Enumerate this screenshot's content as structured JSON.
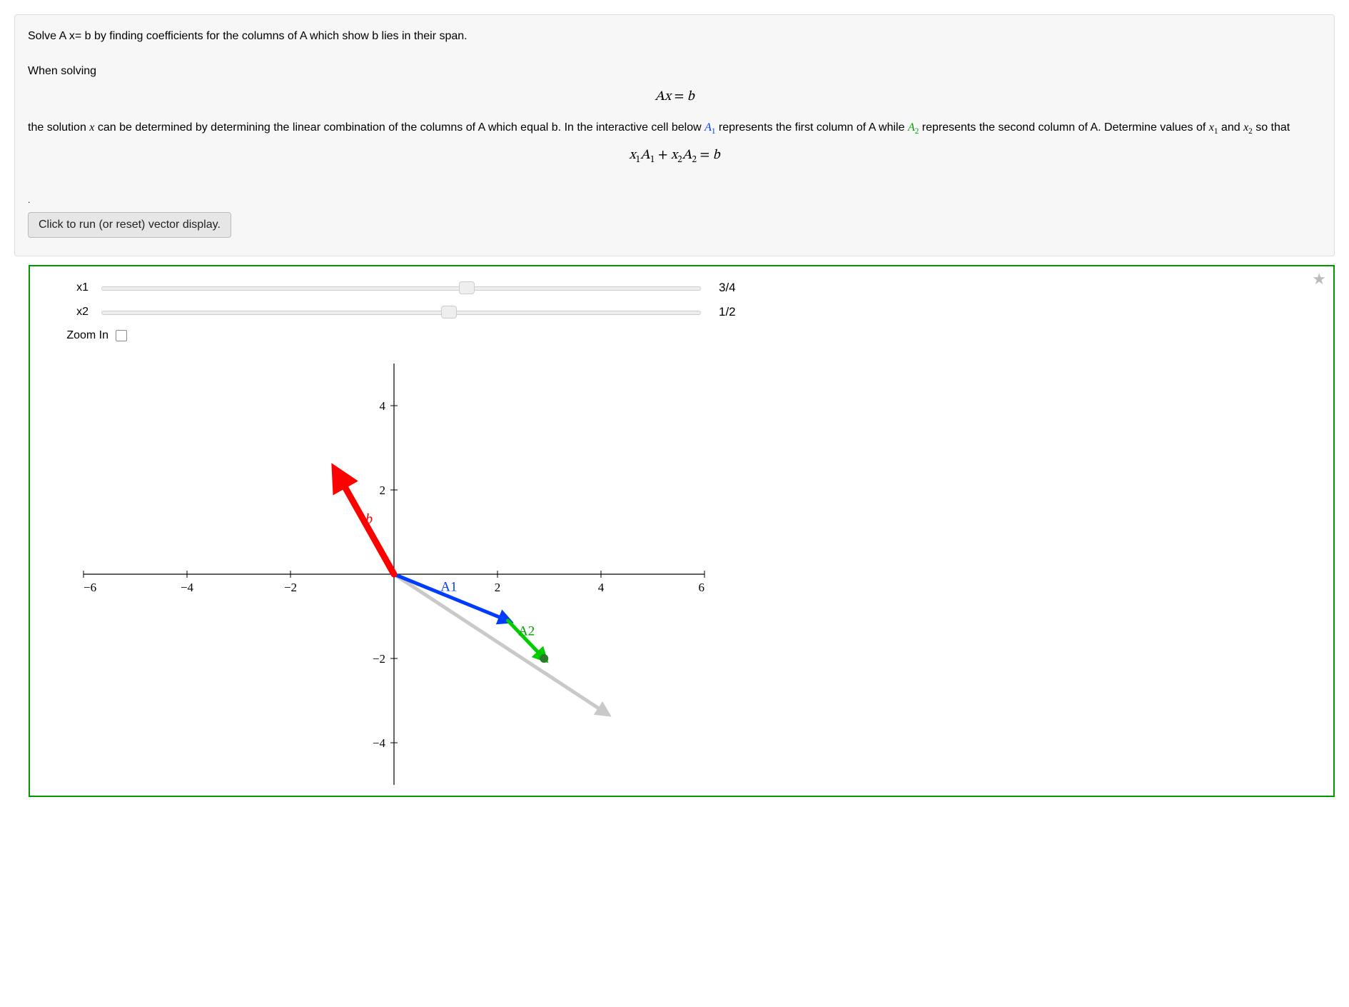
{
  "title": "Solve A x= b by finding coefficients for the columns of A which show b lies in their span.",
  "when": "When solving",
  "eq1": "Ax = b",
  "body1_pre": "the solution ",
  "body1_x": "x",
  "body1_mid1": " can be determined by determining the linear combination of the columns of A which equal b. In the interactive cell below ",
  "body1_A1": "A₁",
  "body1_mid2": " represents the first column of A while ",
  "body1_A2": "A₂",
  "body1_mid3": " represents the second column of A. Determine values of ",
  "body1_x1": "x₁",
  "body1_and": " and ",
  "body1_x2": "x₂",
  "body1_end": " so that",
  "eq2": "x₁A₁ + x₂A₂ = b",
  "run_btn": "Click to run (or reset) vector display.",
  "sliders": {
    "x1": {
      "label": "x1",
      "value": "3/4",
      "pos_pct": 61
    },
    "x2": {
      "label": "x2",
      "value": "1/2",
      "pos_pct": 58
    }
  },
  "zoom_label": "Zoom In",
  "chart_data": {
    "type": "vector-plot",
    "xlim": [
      -6,
      6
    ],
    "ylim": [
      -5,
      5
    ],
    "xticks": [
      -6,
      -4,
      -2,
      2,
      4,
      6
    ],
    "yticks": [
      -4,
      -2,
      2,
      4
    ],
    "vectors": [
      {
        "name": "b",
        "x": -1.1,
        "y": 2.4,
        "color": "#ff0000",
        "thick": 9
      },
      {
        "name": "x1A1",
        "x": 2.2,
        "y": -1.1,
        "color": "#003cff",
        "thick": 5
      },
      {
        "name": "x2A2",
        "x": 0.7,
        "y": -0.9,
        "color": "#00cc00",
        "thick": 5,
        "origin": [
          2.2,
          -1.1
        ]
      },
      {
        "name": "sum",
        "x": 4.1,
        "y": -3.3,
        "color": "#c9c9c9",
        "thick": 5
      }
    ],
    "point": {
      "x": 2.9,
      "y": -2.0,
      "color": "#2a7a2a"
    },
    "labels": [
      {
        "text": "b",
        "x": -0.55,
        "y": 1.2,
        "class": "vlabel-b"
      },
      {
        "text": "A1",
        "x": 0.9,
        "y": -0.4,
        "class": "vlabel-A1"
      },
      {
        "text": "A2",
        "x": 2.4,
        "y": -1.45,
        "class": "vlabel-A2"
      }
    ]
  }
}
